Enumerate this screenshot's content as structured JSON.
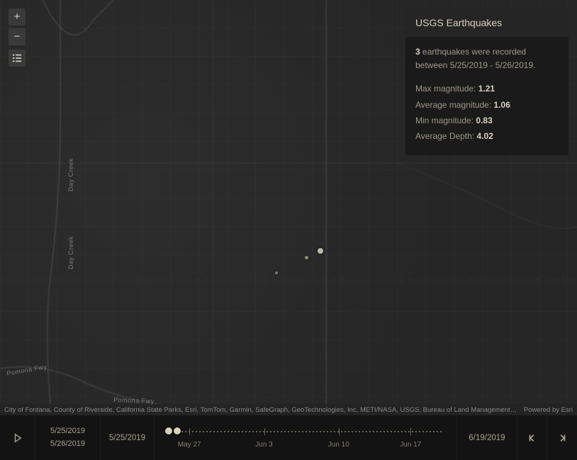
{
  "panel": {
    "title": "USGS Earthquakes",
    "count": "3",
    "summary_text": " earthquakes were recorded between 5/25/2019 - 5/26/2019.",
    "max_mag_label": "Max magnitude: ",
    "max_mag": "1.21",
    "avg_mag_label": "Average magnitude: ",
    "avg_mag": "1.06",
    "min_mag_label": "Min magnitude: ",
    "min_mag": "0.83",
    "avg_depth_label": "Average Depth: ",
    "avg_depth": "4.02"
  },
  "attribution": {
    "sources": "City of Fontana, County of Riverside, California State Parks, Esri, TomTom, Garmin, SafeGraph, GeoTechnologies, Inc, METI/NASA, USGS, Bureau of Land Management, EPA, NP ...",
    "powered": "Powered by Esri"
  },
  "timebar": {
    "range_start": "5/25/2019",
    "range_end": "5/26/2019",
    "current": "5/25/2019",
    "extent_end": "6/19/2019",
    "ticks": [
      "May 27",
      "Jun 3",
      "Jun 10",
      "Jun 17"
    ]
  },
  "roads": {
    "pomona1": "Pomona Fwy",
    "pomona2": "Pomona Fwy",
    "daycreek1": "Day Creek",
    "daycreek2": "Day Creek"
  }
}
